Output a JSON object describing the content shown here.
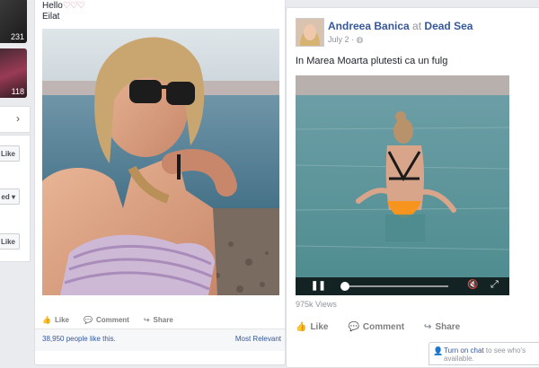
{
  "left_column": {
    "thumb1_count": "231",
    "thumb2_count": "118",
    "like_button_1": "y Like",
    "liked_dropdown": "ed",
    "like_button_2": "y Like"
  },
  "post1": {
    "greeting": "Hello",
    "hearts": "♡♡♡",
    "location": "Eilat",
    "actions": {
      "like": "Like",
      "comment": "Comment",
      "share": "Share"
    },
    "likes_text": "38,950 people like this.",
    "sort_label": "Most Relevant"
  },
  "post2": {
    "author": "Andreea Banica",
    "at_label": "at",
    "place": "Dead Sea",
    "date": "July 2",
    "caption": "In Marea Moarta plutesti ca un fulg",
    "views": "975k Views",
    "actions": {
      "like": "Like",
      "comment": "Comment",
      "share": "Share"
    }
  },
  "chat": {
    "link": "Turn on chat",
    "text": "to see who's available."
  },
  "colors": {
    "link": "#365899",
    "accent_pink": "#e8779b",
    "bikini": "#f7941d"
  },
  "video": {
    "progress": 0.0,
    "volume": 0.0
  }
}
